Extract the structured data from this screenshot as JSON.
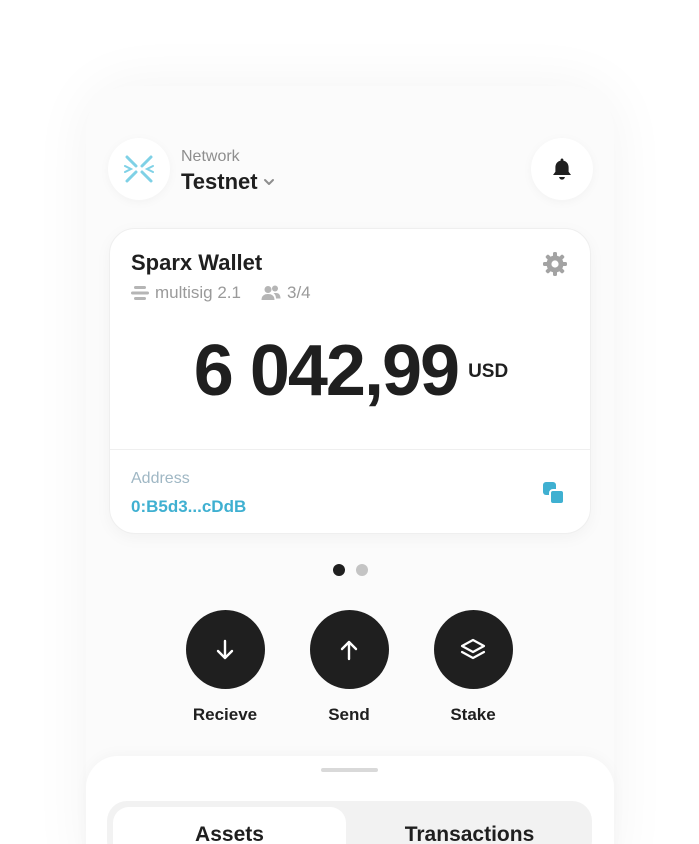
{
  "header": {
    "network_caption": "Network",
    "network_name": "Testnet"
  },
  "wallet": {
    "name": "Sparx Wallet",
    "type": "multisig 2.1",
    "signers": "3/4",
    "balance": "6 042,99",
    "currency": "USD",
    "address_label": "Address",
    "address": "0:B5d3...cDdB"
  },
  "pagination": {
    "current": 1,
    "total": 2
  },
  "actions": [
    {
      "label": "Recieve",
      "icon": "arrow-down-icon"
    },
    {
      "label": "Send",
      "icon": "arrow-up-icon"
    },
    {
      "label": "Stake",
      "icon": "layers-icon"
    }
  ],
  "tabs": [
    {
      "label": "Assets",
      "active": true
    },
    {
      "label": "Transactions",
      "active": false
    }
  ],
  "colors": {
    "accent": "#3fb0d1",
    "logo": "#7fd1e6",
    "dark": "#1f1f1f"
  }
}
